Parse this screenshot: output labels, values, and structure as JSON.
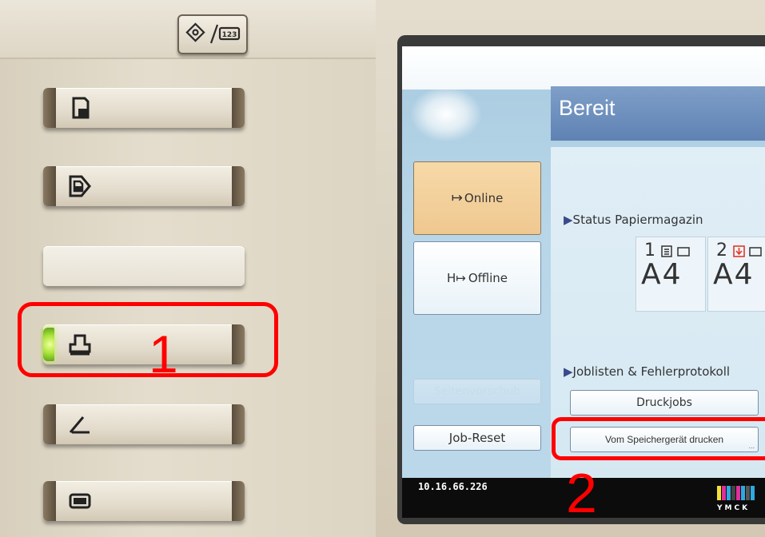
{
  "hardware": {
    "top_key": {
      "icon": "diamond-slash-123-icon",
      "label": "123"
    },
    "buttons": [
      {
        "name": "copy-key",
        "icon": "document-icon"
      },
      {
        "name": "document-server-key",
        "icon": "document-arrow-icon"
      },
      {
        "name": "blank-key",
        "icon": ""
      },
      {
        "name": "printer-key",
        "icon": "printer-icon",
        "led": "on",
        "led_color": "#a8e43a"
      },
      {
        "name": "scanner-key",
        "icon": "scanner-icon"
      },
      {
        "name": "screen-key",
        "icon": "screen-icon"
      }
    ]
  },
  "callouts": [
    {
      "number": "1",
      "color": "#ff0000"
    },
    {
      "number": "2",
      "color": "#ff0000"
    }
  ],
  "lcd": {
    "title": "Bereit",
    "online_label": "Online",
    "online_icon": "online-arrow-icon",
    "offline_label": "Offline",
    "offline_icon": "offline-arrow-icon",
    "seitenvorschub_label": "Seitenvorschub",
    "job_reset_label": "Job-Reset",
    "status_papiermagazin_label": "Status Papiermagazin",
    "trays": [
      {
        "number": "1",
        "size": "A4"
      },
      {
        "number": "2",
        "size": "A4"
      }
    ],
    "joblisten_label": "Joblisten & Fehlerprotokoll",
    "druckjobs_label": "Druckjobs",
    "speichergeraet_label": "Vom Speichergerät drucken",
    "ip_address": "10.16.66.226",
    "toner_letters": "YMCK",
    "colors": {
      "active_button": "#efc890",
      "title_bar": "#6a8bbd",
      "accent": "#3a4a8a"
    }
  }
}
